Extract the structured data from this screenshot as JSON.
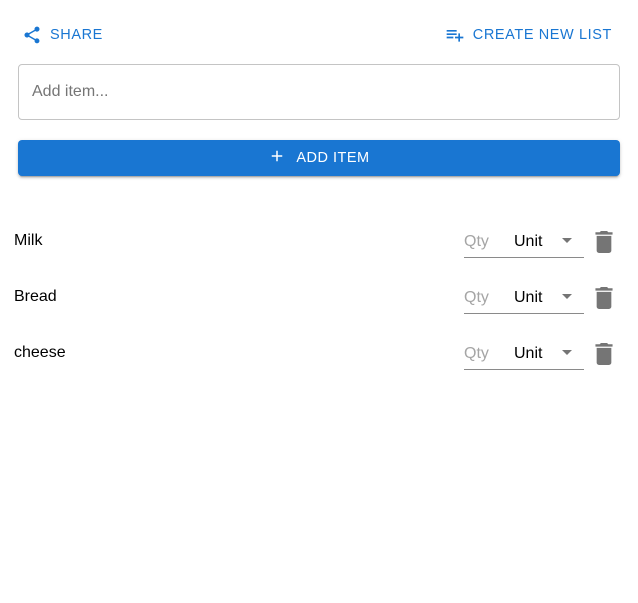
{
  "toolbar": {
    "share_label": "SHARE",
    "create_list_label": "CREATE NEW LIST",
    "share_icon": "share-icon",
    "create_list_icon": "playlist-add-icon"
  },
  "add_item": {
    "placeholder": "Add item...",
    "value": "",
    "button_label": "ADD ITEM",
    "button_icon": "plus-icon"
  },
  "items": [
    {
      "name": "Milk",
      "qty_placeholder": "Qty",
      "unit": "Unit"
    },
    {
      "name": "Bread",
      "qty_placeholder": "Qty",
      "unit": "Unit"
    },
    {
      "name": "cheese",
      "qty_placeholder": "Qty",
      "unit": "Unit"
    }
  ],
  "colors": {
    "primary": "#1976d2",
    "icon_gray": "#757575",
    "placeholder_gray": "#a5a5a5"
  }
}
